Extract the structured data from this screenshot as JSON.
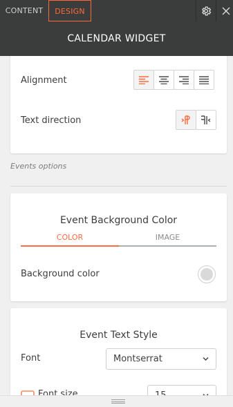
{
  "tabs": {
    "content": "CONTENT",
    "design": "DESIGN"
  },
  "header": {
    "title": "CALENDAR WIDGET"
  },
  "text_settings": {
    "alignment_label": "Alignment",
    "text_direction_label": "Text direction",
    "alignment_selected": "left",
    "direction_selected": "ltr"
  },
  "events_options_caption": "Events options",
  "event_bg": {
    "title": "Event Background Color",
    "tabs": [
      "COLOR",
      "IMAGE"
    ],
    "active_tab": "COLOR",
    "background_label": "Background color",
    "background_value": "#d9d9d9"
  },
  "event_text": {
    "title": "Event Text Style",
    "font_label": "Font",
    "font_value": "Montserrat",
    "font_size_label": "Font size",
    "font_size_value": "15"
  },
  "colors": {
    "accent": "#ff6a3d",
    "topbar": "#3b3c3c",
    "panel_bg": "#f0f0f0"
  },
  "icons": [
    "gear-icon",
    "close-icon",
    "align-left-icon",
    "align-center-icon",
    "align-right-icon",
    "align-justify-icon",
    "ltr-direction-icon",
    "rtl-direction-icon",
    "chevron-down-icon",
    "font-size-icon",
    "drag-handle-icon"
  ]
}
